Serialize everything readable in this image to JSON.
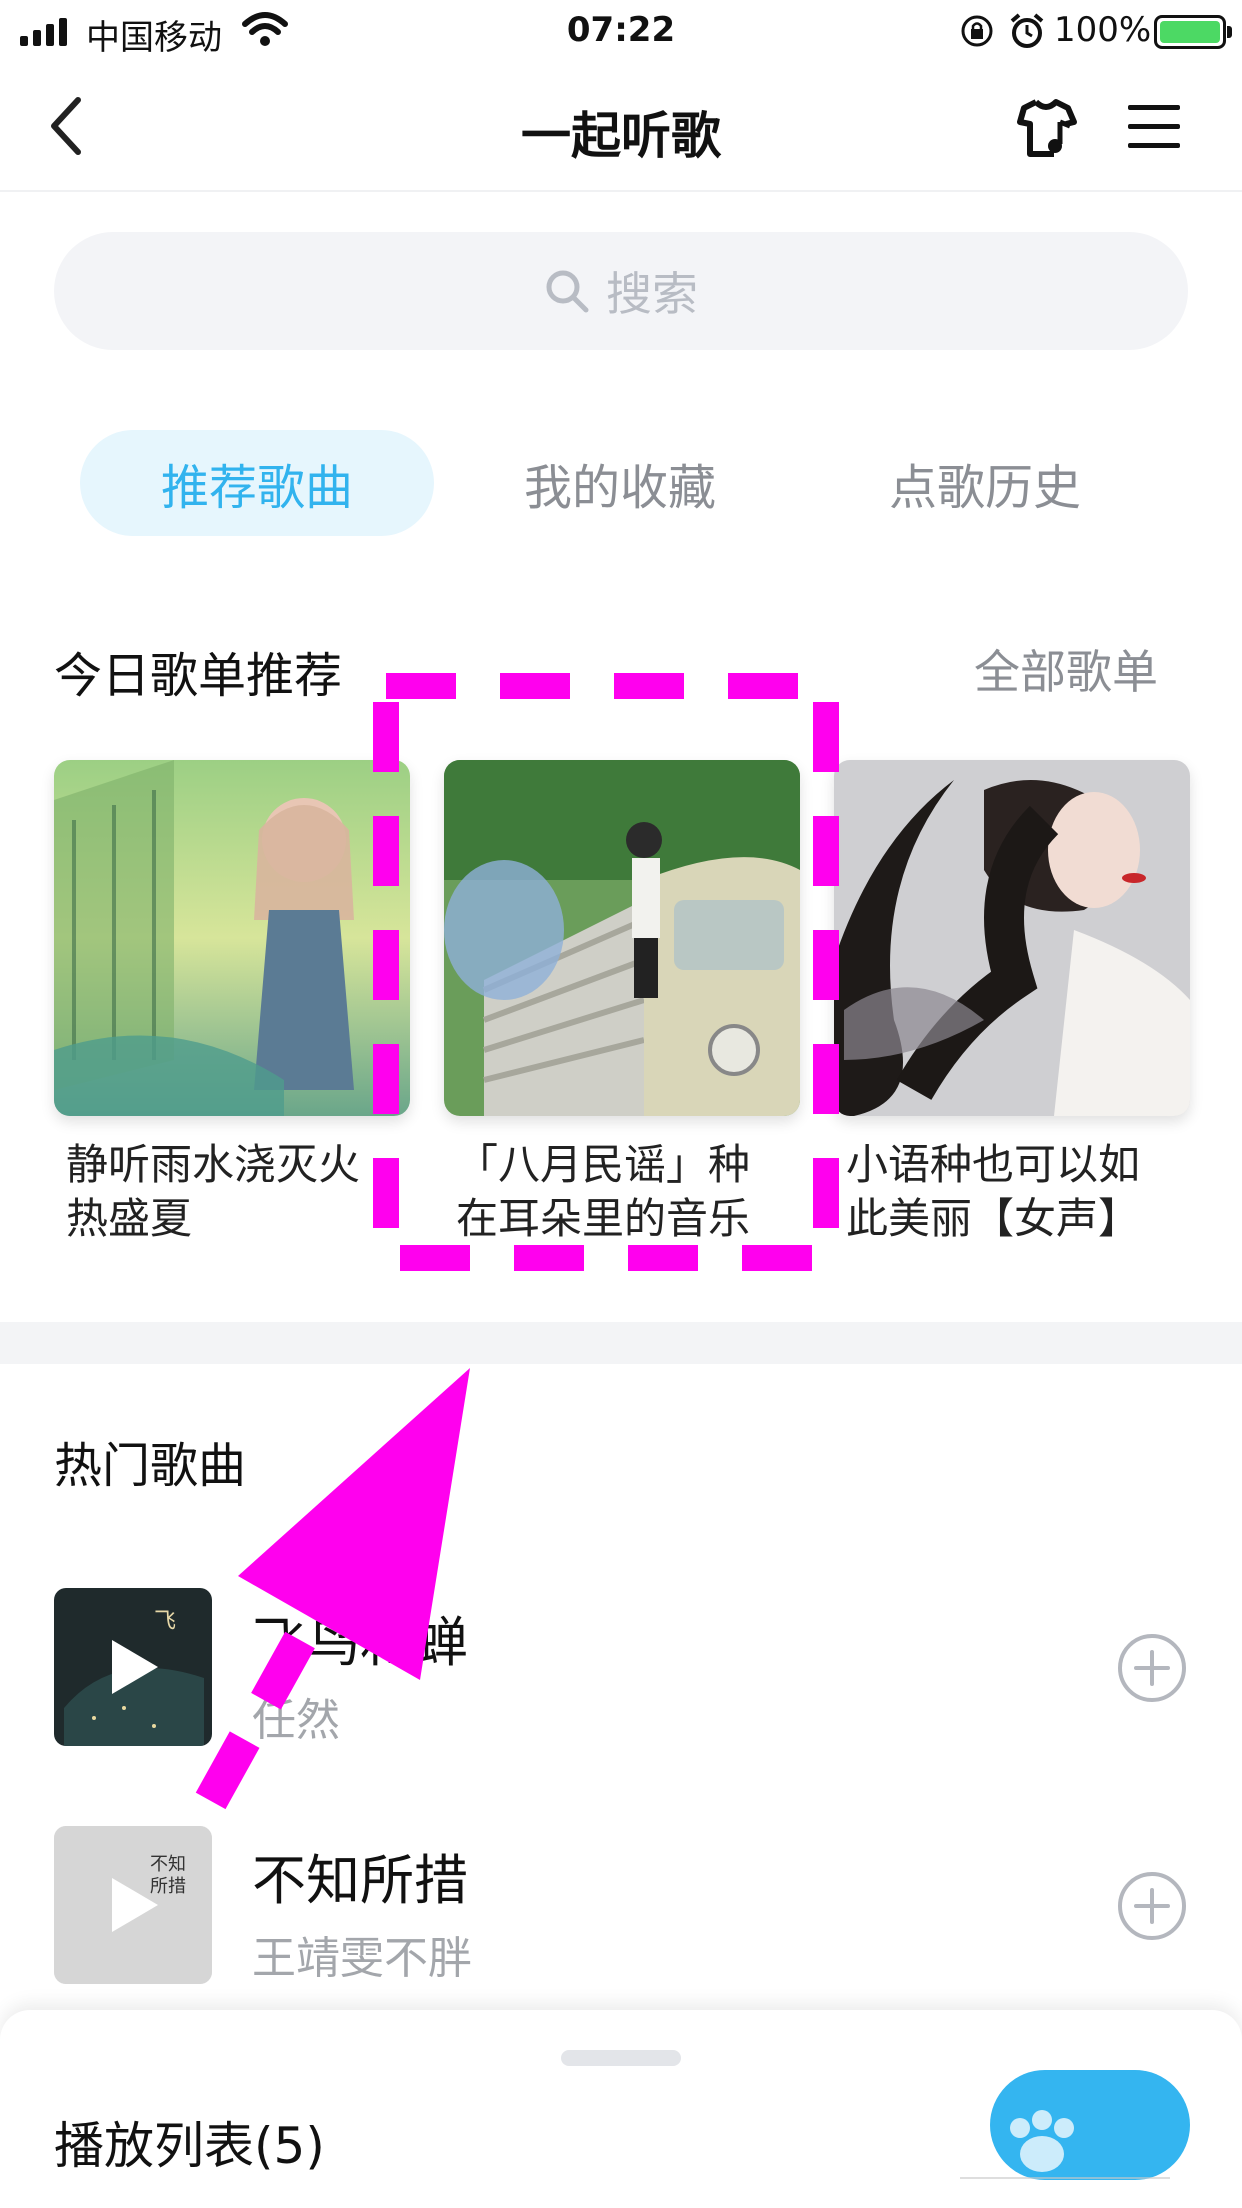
{
  "status_bar": {
    "carrier": "中国移动",
    "time": "07:22",
    "battery": "100%"
  },
  "nav": {
    "title": "一起听歌"
  },
  "search": {
    "placeholder": "搜索"
  },
  "tabs": [
    {
      "label": "推荐歌曲",
      "active": true
    },
    {
      "label": "我的收藏",
      "active": false
    },
    {
      "label": "点歌历史",
      "active": false
    }
  ],
  "playlists_section": {
    "title": "今日歌单推荐",
    "more": "全部歌单",
    "items": [
      {
        "title": "静听雨水浇灭火热盛夏"
      },
      {
        "title": "「八月民谣」种在耳朵里的音乐"
      },
      {
        "title": "小语种也可以如此美丽【女声】"
      }
    ]
  },
  "hot_section": {
    "title": "热门歌曲",
    "songs": [
      {
        "name": "飞鸟和蝉",
        "artist": "任然"
      },
      {
        "name": "不知所措",
        "artist": "王靖雯不胖"
      }
    ]
  },
  "playbar": {
    "label": "播放列表(5)"
  },
  "colors": {
    "accent": "#31b3ee",
    "annotation": "#ff00ee"
  }
}
